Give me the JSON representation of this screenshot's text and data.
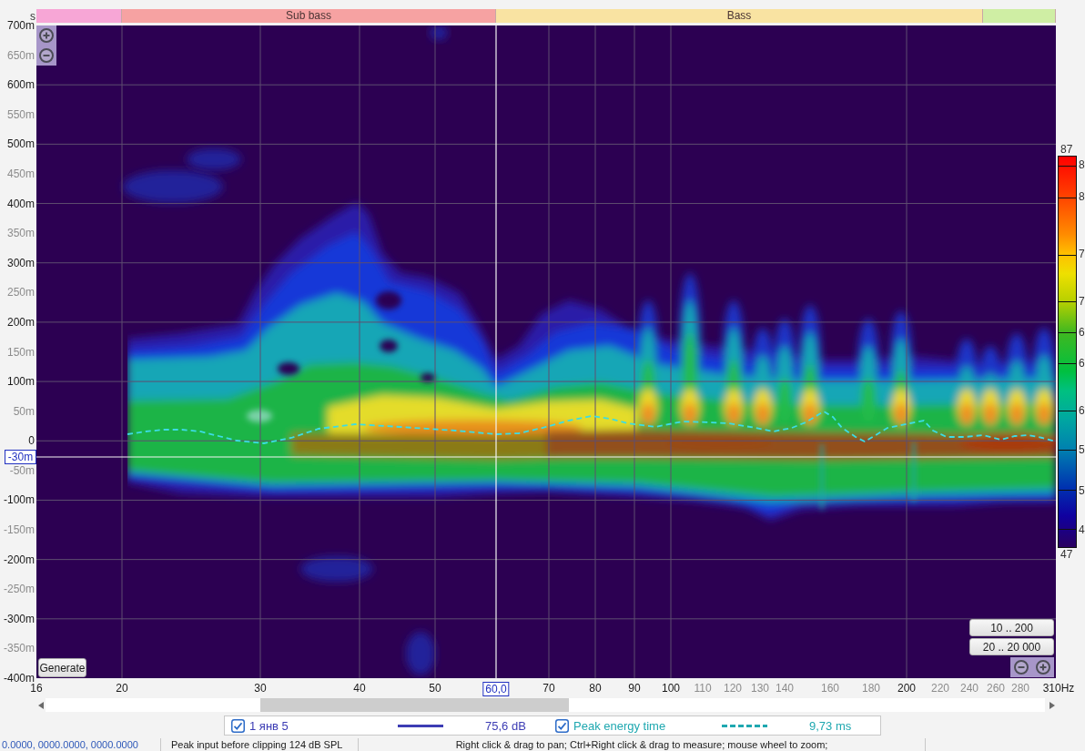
{
  "band_bar": {
    "leading_label": "s",
    "bands": [
      {
        "color": "#f7a6d6"
      },
      {
        "label": "Sub bass",
        "color": "#f6a2a2"
      },
      {
        "label": "Bass",
        "color": "#f9e3a2"
      },
      {
        "color": "#cfeea4"
      }
    ]
  },
  "y_axis": {
    "ticks": [
      {
        "label": "700m",
        "kind": "major"
      },
      {
        "label": "650m",
        "kind": "minor"
      },
      {
        "label": "600m",
        "kind": "major"
      },
      {
        "label": "550m",
        "kind": "minor"
      },
      {
        "label": "500m",
        "kind": "major"
      },
      {
        "label": "450m",
        "kind": "minor"
      },
      {
        "label": "400m",
        "kind": "major"
      },
      {
        "label": "350m",
        "kind": "minor"
      },
      {
        "label": "300m",
        "kind": "major"
      },
      {
        "label": "250m",
        "kind": "minor"
      },
      {
        "label": "200m",
        "kind": "major"
      },
      {
        "label": "150m",
        "kind": "minor"
      },
      {
        "label": "100m",
        "kind": "major"
      },
      {
        "label": "50m",
        "kind": "minor"
      },
      {
        "label": "0",
        "kind": "major"
      },
      {
        "label": "-50m",
        "kind": "minor"
      },
      {
        "label": "-100m",
        "kind": "major"
      },
      {
        "label": "-150m",
        "kind": "minor"
      },
      {
        "label": "-200m",
        "kind": "major"
      },
      {
        "label": "-250m",
        "kind": "minor"
      },
      {
        "label": "-300m",
        "kind": "major"
      },
      {
        "label": "-350m",
        "kind": "minor"
      },
      {
        "label": "-400m",
        "kind": "major"
      }
    ],
    "cursor_readout": "-30m"
  },
  "plot": {
    "generate_button": "Generate",
    "range_buttons": [
      "10 .. 200",
      "20 .. 20 000"
    ]
  },
  "color_scale": {
    "max_label": "87",
    "tick_labels": [
      "8",
      "8",
      "7",
      "7",
      "6",
      "6",
      "6",
      "5",
      "5",
      "4"
    ],
    "min_label": "47"
  },
  "x_axis": {
    "ticks": [
      {
        "label": "16",
        "kind": "major"
      },
      {
        "label": "20",
        "kind": "major"
      },
      {
        "label": "30",
        "kind": "major"
      },
      {
        "label": "40",
        "kind": "major"
      },
      {
        "label": "50",
        "kind": "major"
      },
      {
        "label": "70",
        "kind": "major"
      },
      {
        "label": "80",
        "kind": "major"
      },
      {
        "label": "90",
        "kind": "major"
      },
      {
        "label": "100",
        "kind": "major"
      },
      {
        "label": "110",
        "kind": "minor"
      },
      {
        "label": "120",
        "kind": "minor"
      },
      {
        "label": "130",
        "kind": "minor"
      },
      {
        "label": "140",
        "kind": "minor"
      },
      {
        "label": "160",
        "kind": "minor"
      },
      {
        "label": "180",
        "kind": "minor"
      },
      {
        "label": "200",
        "kind": "major"
      },
      {
        "label": "220",
        "kind": "minor"
      },
      {
        "label": "240",
        "kind": "minor"
      },
      {
        "label": "260",
        "kind": "minor"
      },
      {
        "label": "280",
        "kind": "minor"
      },
      {
        "label": "310Hz",
        "kind": "major"
      }
    ],
    "cursor_readout": "60,0"
  },
  "legend": [
    {
      "checked": true,
      "label": "1 янв 5",
      "kind": "solid",
      "value": "75,6 dB",
      "color": "#3c3cb4"
    },
    {
      "checked": true,
      "label": "Peak energy time",
      "kind": "dashed",
      "value": "9,73 ms",
      "color": "#1fa8b0"
    }
  ],
  "status_bar": [
    "0.0000, 0000.0000, 0000.0000",
    "Peak input before clipping 124 dB SPL",
    "Right click & drag to pan; Ctrl+Right click & drag to measure; mouse wheel to zoom;"
  ]
}
